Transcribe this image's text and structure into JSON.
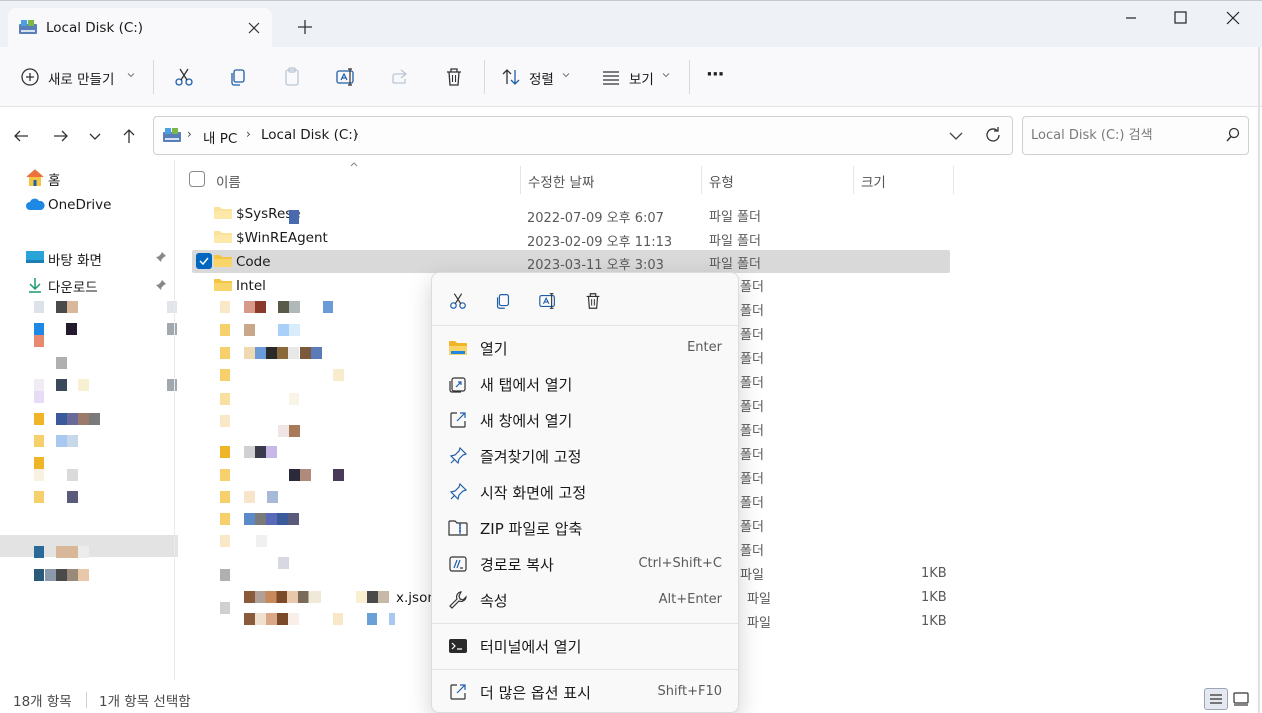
{
  "window": {
    "tab_title": "Local Disk (C:)",
    "new_tab_glyph": "+"
  },
  "commandbar": {
    "new_label": "새로 만들기",
    "sort_label": "정렬",
    "view_label": "보기",
    "more_glyph": "···"
  },
  "address": {
    "crumbs": [
      "내 PC",
      "Local Disk (C:)"
    ],
    "search_placeholder": "Local Disk (C:) 검색"
  },
  "sidebar": {
    "home": "홈",
    "onedrive": "OneDrive",
    "desktop": "바탕 화면",
    "downloads": "다운로드"
  },
  "columns": {
    "name": "이름",
    "modified": "수정한 날짜",
    "type": "유형",
    "size": "크기"
  },
  "files": [
    {
      "name": "$SysRese",
      "date": "2022-07-09 오후 6:07",
      "type": "파일 폴더",
      "size": ""
    },
    {
      "name": "$WinREAgent",
      "date": "2023-02-09 오후 11:13",
      "type": "파일 폴더",
      "size": ""
    },
    {
      "name": "Code",
      "date": "2023-03-11 오후 3:03",
      "type": "파일 폴더",
      "size": "",
      "selected": true
    },
    {
      "name": "Intel",
      "date": "",
      "type": "",
      "size": ""
    }
  ],
  "hidden_rows": {
    "type_partial": "폴더",
    "type_file_short": "파일",
    "type_file": "파일",
    "size": "1KB",
    "json_suffix": "x.json"
  },
  "context_menu": {
    "items": [
      {
        "label": "열기",
        "shortcut": "Enter",
        "icon": "folder-open-icon"
      },
      {
        "label": "새 탭에서 열기",
        "shortcut": "",
        "icon": "new-tab-icon"
      },
      {
        "label": "새 창에서 열기",
        "shortcut": "",
        "icon": "new-window-icon"
      },
      {
        "label": "즐겨찾기에 고정",
        "shortcut": "",
        "icon": "pin-icon"
      },
      {
        "label": "시작 화면에 고정",
        "shortcut": "",
        "icon": "pin-icon"
      },
      {
        "label": "ZIP 파일로 압축",
        "shortcut": "",
        "icon": "zip-icon"
      },
      {
        "label": "경로로 복사",
        "shortcut": "Ctrl+Shift+C",
        "icon": "copy-path-icon"
      },
      {
        "label": "속성",
        "shortcut": "Alt+Enter",
        "icon": "wrench-icon"
      },
      {
        "label": "터미널에서 열기",
        "shortcut": "",
        "icon": "terminal-icon"
      },
      {
        "label": "더 많은 옵션 표시",
        "shortcut": "Shift+F10",
        "icon": "more-options-icon"
      }
    ]
  },
  "status": {
    "item_count": "18개 항목",
    "selected_count": "1개 항목 선택함"
  },
  "colors": {
    "accent": "#0067c0",
    "selection": "#d9d9d9",
    "folder": "#f4c542"
  }
}
